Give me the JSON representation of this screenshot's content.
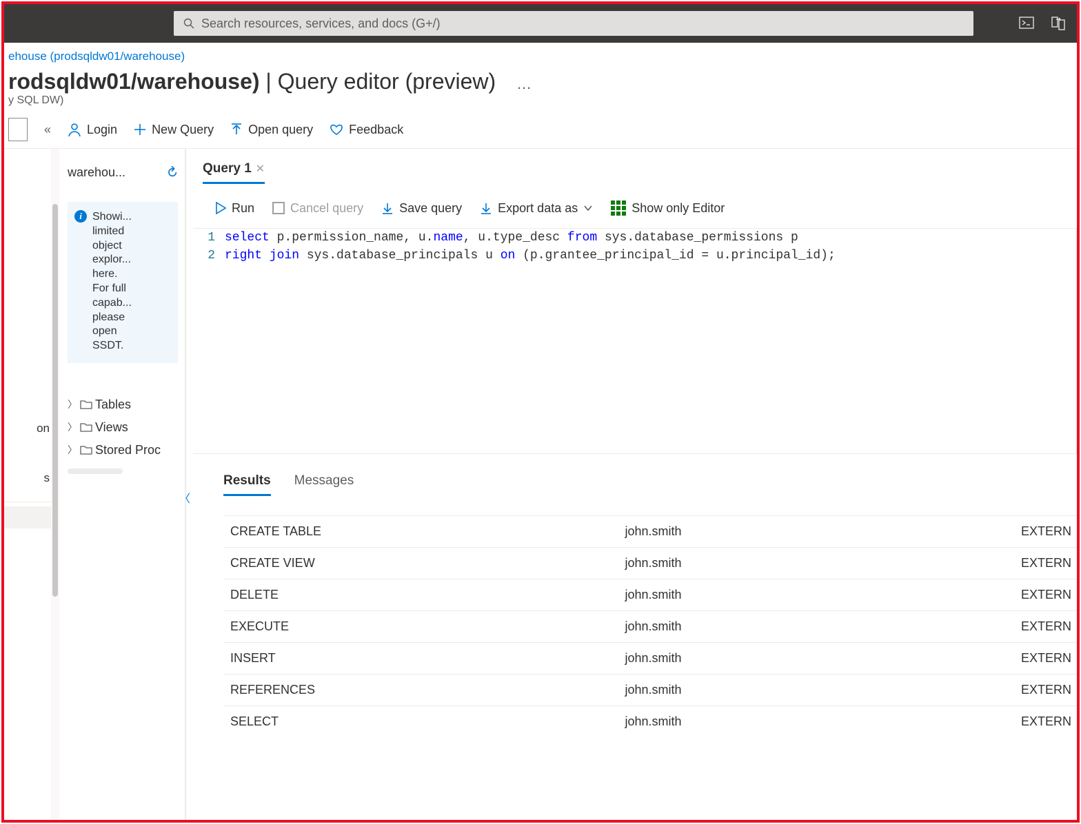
{
  "top": {
    "search_placeholder": "Search resources, services, and docs (G+/)"
  },
  "breadcrumb": {
    "link": "ehouse (prodsqldw01/warehouse)"
  },
  "header": {
    "title_left": "rodsqldw01/warehouse)",
    "title_right": " | Query editor (preview)",
    "subtitle": "y SQL DW)",
    "ellipsis": "…"
  },
  "cmd": {
    "login": "Login",
    "new_query": "New Query",
    "open_query": "Open query",
    "feedback": "Feedback"
  },
  "left_rail": {
    "item1": "on",
    "item2": "s"
  },
  "explorer": {
    "db_name": "warehou...",
    "info_text": "Showi...\nlimited\nobject\nexplor...\nhere.\nFor full\ncapab...\nplease\nopen\nSSDT.",
    "tree": {
      "tables": "Tables",
      "views": "Views",
      "sprocs": "Stored Proc"
    }
  },
  "tabs": {
    "query1": "Query 1"
  },
  "query_toolbar": {
    "run": "Run",
    "cancel": "Cancel query",
    "save": "Save query",
    "export": "Export data as",
    "show_editor": "Show only Editor"
  },
  "editor": {
    "lines": [
      {
        "num": "1",
        "tokens": [
          {
            "t": "select ",
            "c": "kw"
          },
          {
            "t": "p.permission_name, u.",
            "c": ""
          },
          {
            "t": "name",
            "c": "kw"
          },
          {
            "t": ", u.type_desc ",
            "c": ""
          },
          {
            "t": "from ",
            "c": "kw"
          },
          {
            "t": "sys.database_permissions p",
            "c": ""
          }
        ]
      },
      {
        "num": "2",
        "tokens": [
          {
            "t": "right join ",
            "c": "kw"
          },
          {
            "t": "sys.database_principals u ",
            "c": ""
          },
          {
            "t": "on ",
            "c": "kw"
          },
          {
            "t": "(p.grantee_principal_id = u.principal_id);",
            "c": ""
          }
        ]
      }
    ]
  },
  "results": {
    "tab_results": "Results",
    "tab_messages": "Messages",
    "rows": [
      {
        "perm": "CREATE TABLE",
        "user": "john.smith",
        "type": "EXTERN"
      },
      {
        "perm": "CREATE VIEW",
        "user": "john.smith",
        "type": "EXTERN"
      },
      {
        "perm": "DELETE",
        "user": "john.smith",
        "type": "EXTERN"
      },
      {
        "perm": "EXECUTE",
        "user": "john.smith",
        "type": "EXTERN"
      },
      {
        "perm": "INSERT",
        "user": "john.smith",
        "type": "EXTERN"
      },
      {
        "perm": "REFERENCES",
        "user": "john.smith",
        "type": "EXTERN"
      },
      {
        "perm": "SELECT",
        "user": "john.smith",
        "type": "EXTERN"
      }
    ]
  }
}
